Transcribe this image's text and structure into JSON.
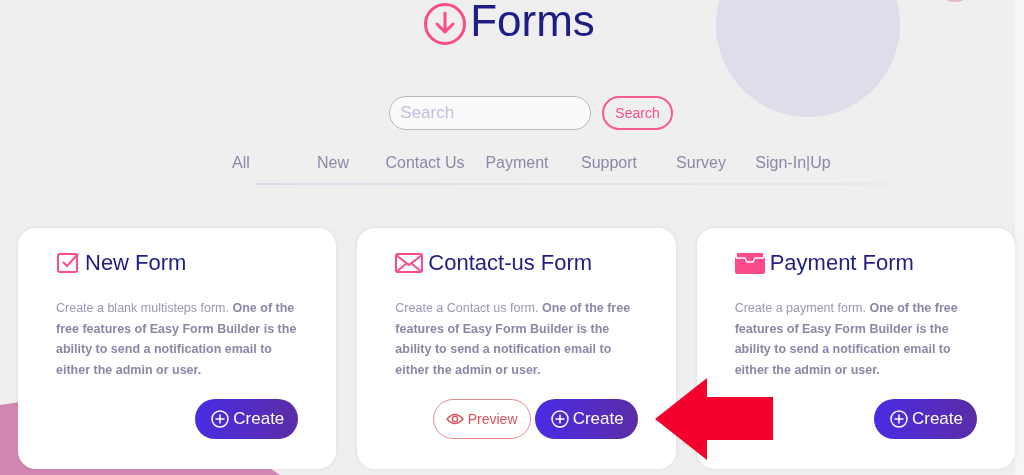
{
  "header": {
    "title": "Forms"
  },
  "search": {
    "placeholder": "Search",
    "button": "Search"
  },
  "tabs": [
    {
      "label": "All",
      "selected": false
    },
    {
      "label": "New",
      "selected": false
    },
    {
      "label": "Contact Us",
      "selected": false
    },
    {
      "label": "Payment",
      "selected": false
    },
    {
      "label": "Support",
      "selected": false
    },
    {
      "label": "Survey",
      "selected": false
    },
    {
      "label": "Sign-In|Up",
      "selected": false
    }
  ],
  "cards": [
    {
      "kind": "checkbox",
      "title": "New Form",
      "description": "Create a blank multisteps form. **One of the free features of Easy Form Builder is the ability to send a notification email to either the admin or user.**",
      "buttons": [
        {
          "kind": "create",
          "label": "Create"
        }
      ]
    },
    {
      "kind": "envelope",
      "title": "Contact-us Form",
      "description": "Create a Contact us form. **One of the free features of Easy Form Builder is the ability to send a notification email to either the admin or user.**",
      "buttons": [
        {
          "kind": "preview",
          "label": "Preview"
        },
        {
          "kind": "create",
          "label": "Create"
        }
      ]
    },
    {
      "kind": "wallet",
      "title": "Payment Form",
      "description": "Create a payment form. **One of the free features of Easy Form Builder is the ability to send a notification email to either the admin or user.**",
      "buttons": [
        {
          "kind": "create",
          "label": "Create"
        }
      ]
    }
  ]
}
